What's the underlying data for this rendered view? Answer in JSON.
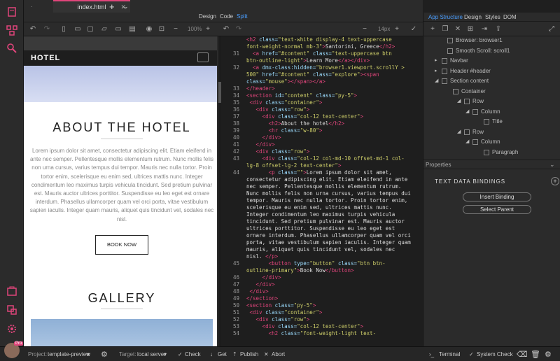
{
  "tabs": {
    "file": "index.html",
    "plus": "+",
    "chevron": "⌄"
  },
  "modes": {
    "design": "Design",
    "code": "Code",
    "split": "Split"
  },
  "toolbar": {
    "zoom": "100%",
    "font_size": "14px"
  },
  "preview": {
    "brand": "HOTEL",
    "about_title": "ABOUT THE HOTEL",
    "about_text": "Lorem ipsum dolor sit amet, consectetur adipiscing elit. Etiam eleifend in ante nec semper. Pellentesque mollis elementum rutrum. Nunc mollis felis non urna cursus, varius tempus dui tempor. Mauris nec nulla tortor. Proin tortor enim, scelerisque eu enim sed, ultrices mattis nunc. Integer condimentum leo maximus turpis vehicula tincidunt. Sed pretium pulvinar est. Mauris auctor ultrices porttitor. Suspendisse eu leo eget est ornare interdum. Phasellus ullamcorper quam vel orci porta, vitae vestibulum sapien iaculis. Integer quam mauris, aliquet quis tincidunt vel, sodales nec nisl.",
    "book_now": "BOOK NOW",
    "gallery_title": "GALLERY"
  },
  "code_lines": [
    {
      "n": "",
      "html": "<span class='tg'>&lt;h2</span> <span class='at'>class=</span><span class='st'>\"text-white display-4 text-uppercase</span>"
    },
    {
      "n": "",
      "html": "<span class='st'>font-weight-normal mb-3\"</span><span class='tg'>&gt;</span>Santorini, Greece<span class='tg'>&lt;/h2&gt;</span>"
    },
    {
      "n": "31",
      "html": "  <span class='tg'>&lt;a</span> <span class='at'>href=</span><span class='st'>\"#content\"</span> <span class='at'>class=</span><span class='st'>\"text-uppercase btn</span>"
    },
    {
      "n": "",
      "html": "<span class='st'>btn-outline-light\"</span><span class='tg'>&gt;</span>Learn More<span class='tg'>&lt;/a&gt;&lt;/div&gt;</span>"
    },
    {
      "n": "32",
      "html": "  <span class='tg'>&lt;a</span> <span class='at'>dmx-class:hidden=</span><span class='st'>\"browser1.viewport.scrollY &gt;</span>"
    },
    {
      "n": "",
      "html": "<span class='st'>500\"</span> <span class='at'>href=</span><span class='st'>\"#content\"</span> <span class='at'>class=</span><span class='st'>\"explore\"</span><span class='tg'>&gt;&lt;span</span>"
    },
    {
      "n": "",
      "html": "<span class='at'>class=</span><span class='st'>\"mouse\"</span><span class='tg'>&gt;&lt;/span&gt;&lt;/a&gt;</span>"
    },
    {
      "n": "33",
      "html": "<span class='tg'>&lt;/header&gt;</span>"
    },
    {
      "n": "34",
      "html": "<span class='tg'>&lt;section</span> <span class='at'>id=</span><span class='st'>\"content\"</span> <span class='at'>class=</span><span class='st'>\"py-5\"</span><span class='tg'>&gt;</span>"
    },
    {
      "n": "35",
      "html": " <span class='tg'>&lt;div</span> <span class='at'>class=</span><span class='st'>\"container\"</span><span class='tg'>&gt;</span>"
    },
    {
      "n": "36",
      "html": "   <span class='tg'>&lt;div</span> <span class='at'>class=</span><span class='st'>\"row\"</span><span class='tg'>&gt;</span>"
    },
    {
      "n": "37",
      "html": "     <span class='tg'>&lt;div</span> <span class='at'>class=</span><span class='st'>\"col-12 text-center\"</span><span class='tg'>&gt;</span>"
    },
    {
      "n": "38",
      "html": "       <span class='tg'>&lt;h2&gt;</span>About the hotel<span class='tg'>&lt;/h2&gt;</span>"
    },
    {
      "n": "39",
      "html": "       <span class='tg'>&lt;hr</span> <span class='at'>class=</span><span class='st'>\"w-80\"</span><span class='tg'>&gt;</span>"
    },
    {
      "n": "40",
      "html": "     <span class='tg'>&lt;/div&gt;</span>"
    },
    {
      "n": "41",
      "html": "   <span class='tg'>&lt;/div&gt;</span>"
    },
    {
      "n": "42",
      "html": "   <span class='tg'>&lt;div</span> <span class='at'>class=</span><span class='st'>\"row\"</span><span class='tg'>&gt;</span>"
    },
    {
      "n": "43",
      "html": "     <span class='tg'>&lt;div</span> <span class='at'>class=</span><span class='st'>\"col-12 col-md-10 offset-md-1 col-</span>"
    },
    {
      "n": "",
      "html": "<span class='st'>lg-8 offset-lg-2 text-center\"</span><span class='tg'>&gt;</span>"
    },
    {
      "n": "44",
      "html": "       <span class='tg'>&lt;p</span> <span class='at'>class=</span><span class='st'>\"\"</span><span class='tg'>&gt;</span>Lorem ipsum dolor sit amet,"
    },
    {
      "n": "",
      "html": "consectetur adipiscing elit. Etiam eleifend in ante"
    },
    {
      "n": "",
      "html": "nec semper. Pellentesque mollis elementum rutrum."
    },
    {
      "n": "",
      "html": "Nunc mollis felis non urna cursus, varius tempus dui"
    },
    {
      "n": "",
      "html": "tempor. Mauris nec nulla tortor. Proin tortor enim,"
    },
    {
      "n": "",
      "html": "scelerisque eu enim sed, ultrices mattis nunc."
    },
    {
      "n": "",
      "html": "Integer condimentum leo maximus turpis vehicula"
    },
    {
      "n": "",
      "html": "tincidunt. Sed pretium pulvinar est. Mauris auctor"
    },
    {
      "n": "",
      "html": "ultrices porttitor. Suspendisse eu leo eget est"
    },
    {
      "n": "",
      "html": "ornare interdum. Phasellus ullamcorper quam vel orci"
    },
    {
      "n": "",
      "html": "porta, vitae vestibulum sapien iaculis. Integer quam"
    },
    {
      "n": "",
      "html": "mauris, aliquet quis tincidunt vel, sodales nec"
    },
    {
      "n": "",
      "html": "nisl. <span class='tg'>&lt;/p&gt;</span>"
    },
    {
      "n": "45",
      "html": "       <span class='tg'>&lt;button</span> <span class='at'>type=</span><span class='st'>\"button\"</span> <span class='at'>class=</span><span class='st'>\"btn btn-</span>"
    },
    {
      "n": "",
      "html": "<span class='st'>outline-primary\"</span><span class='tg'>&gt;</span>Book Now<span class='tg'>&lt;/button&gt;</span>"
    },
    {
      "n": "46",
      "html": "     <span class='tg'>&lt;/div&gt;</span>"
    },
    {
      "n": "47",
      "html": "   <span class='tg'>&lt;/div&gt;</span>"
    },
    {
      "n": "48",
      "html": " <span class='tg'>&lt;/div&gt;</span>"
    },
    {
      "n": "49",
      "html": "<span class='tg'>&lt;/section&gt;</span>"
    },
    {
      "n": "50",
      "html": "<span class='tg'>&lt;section</span> <span class='at'>class=</span><span class='st'>\"py-5\"</span><span class='tg'>&gt;</span>"
    },
    {
      "n": "51",
      "html": " <span class='tg'>&lt;div</span> <span class='at'>class=</span><span class='st'>\"container\"</span><span class='tg'>&gt;</span>"
    },
    {
      "n": "52",
      "html": "   <span class='tg'>&lt;div</span> <span class='at'>class=</span><span class='st'>\"row\"</span><span class='tg'>&gt;</span>"
    },
    {
      "n": "53",
      "html": "     <span class='tg'>&lt;div</span> <span class='at'>class=</span><span class='st'>\"col-12 text-center\"</span><span class='tg'>&gt;</span>"
    },
    {
      "n": "54",
      "html": "       <span class='tg'>&lt;h2</span> <span class='at'>class=</span><span class='st'>\"font-weight-light text-</span>"
    }
  ],
  "right_tabs": {
    "app": "App Structure",
    "design": "Design",
    "styles": "Styles",
    "dom": "DOM"
  },
  "tree": [
    {
      "label": "Browser: browser1",
      "arrow": ""
    },
    {
      "label": "Smooth Scroll: scroll1",
      "arrow": ""
    },
    {
      "label": "Navbar",
      "arrow": "▸"
    },
    {
      "label": "Header #header",
      "arrow": "▸"
    },
    {
      "label": "Section content",
      "arrow": "◢"
    },
    {
      "label": "Container",
      "arrow": ""
    },
    {
      "label": "Row",
      "arrow": "◢"
    },
    {
      "label": "Column",
      "arrow": "◢"
    },
    {
      "label": "Title",
      "arrow": ""
    },
    {
      "label": "Row",
      "arrow": "◢"
    },
    {
      "label": "Column",
      "arrow": "◢"
    },
    {
      "label": "Paragraph",
      "arrow": ""
    }
  ],
  "properties": {
    "title": "Properties",
    "section": "TEXT DATA BINDINGS",
    "insert": "Insert Binding",
    "select_parent": "Select Parent"
  },
  "status": {
    "project_label": "Project:",
    "project": "template-preview",
    "target_label": "Target:",
    "target": "local server",
    "check": "Check",
    "get": "Get",
    "publish": "Publish",
    "abort": "Abort",
    "terminal": "Terminal",
    "system_check": "System Check",
    "pro_badge": "Pro"
  },
  "colors": {
    "accent": "#e0457b",
    "tab_blue": "#4a9eff"
  }
}
